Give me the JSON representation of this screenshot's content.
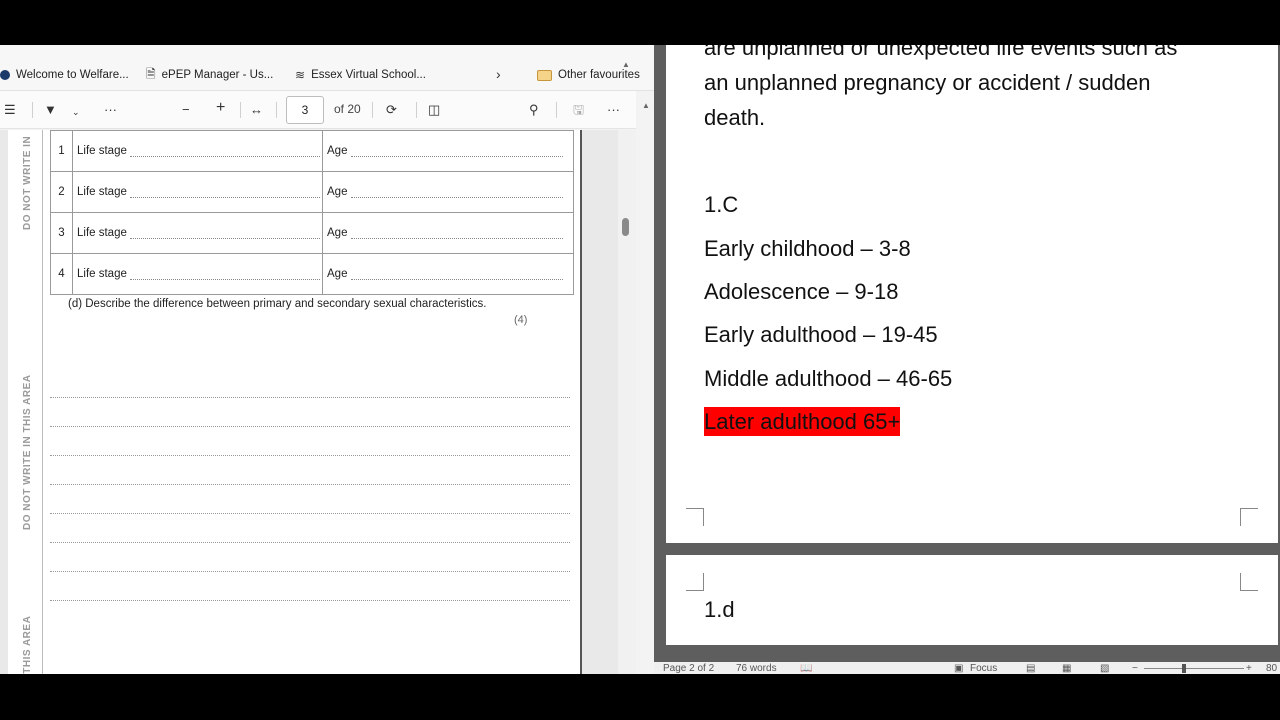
{
  "browser": {
    "favourites": [
      {
        "label": "Welcome to Welfare...",
        "icon": "site-logo-icon"
      },
      {
        "label": "ePEP Manager - Us...",
        "icon": "page-icon"
      },
      {
        "label": "Essex Virtual School...",
        "icon": "wave-icon"
      }
    ],
    "other_favourites": "Other favourites"
  },
  "pdf_toolbar": {
    "current_page": "3",
    "page_of": "of 20"
  },
  "pdf": {
    "margin_notes": [
      "DO NOT WRITE IN",
      "DO NOT WRITE IN THIS AREA",
      "WRITE IN THIS AREA"
    ],
    "rows": [
      {
        "num": "1",
        "stage": "Life stage",
        "age": "Age"
      },
      {
        "num": "2",
        "stage": "Life stage",
        "age": "Age"
      },
      {
        "num": "3",
        "stage": "Life stage",
        "age": "Age"
      },
      {
        "num": "4",
        "stage": "Life stage",
        "age": "Age"
      }
    ],
    "question_d": "(d)  Describe the difference between primary and secondary sexual characteristics.",
    "marks": "(4)"
  },
  "word": {
    "page1_lines": [
      "are unplanned or unexpected life events such as",
      "an unplanned pregnancy or accident / sudden",
      "death.",
      "1.C",
      "Early childhood – 3-8",
      "Adolescence – 9-18",
      "Early adulthood – 19-45",
      "Middle adulthood – 46-65",
      "Later adulthood 65+"
    ],
    "page2_heading": "1.d",
    "status": {
      "page": "Page 2 of 2",
      "words": "76 words",
      "focus": "Focus",
      "zoom": "80"
    },
    "highlight_color": "#ff0000"
  }
}
